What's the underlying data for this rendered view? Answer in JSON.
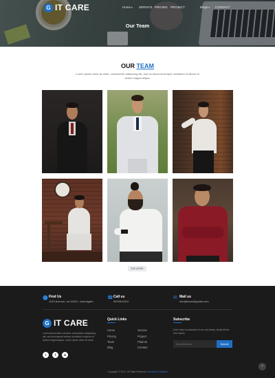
{
  "brand": {
    "logo_mark": "G",
    "name": "IT CARE"
  },
  "nav": {
    "items": [
      {
        "label": "Home",
        "has_caret": true
      },
      {
        "label": "SERVICE",
        "has_caret": false
      },
      {
        "label": "PRICING",
        "has_caret": false
      },
      {
        "label": "PROJECT",
        "has_caret": false
      },
      {
        "label": "Blogs",
        "has_caret": true
      },
      {
        "label": "CONTACT",
        "has_caret": false
      }
    ],
    "caret": "▾"
  },
  "hero": {
    "title": "Our Team"
  },
  "team": {
    "title_prefix": "OUR",
    "title_accent": "TEAM",
    "subtitle": "Lorem ipsum dolor sit amet, consectetur adipiscing elit, sed do eiusmod tempor incididunt ut labore et dolore magna aliqua.",
    "see_more": "SEE MORE",
    "accent_color": "#1f6fc4"
  },
  "footer": {
    "contacts": [
      {
        "icon": "map-marker-icon",
        "glyph": "⬤",
        "label": "Find Us",
        "value": "1010 Avenue, sw 54321, chandigarh"
      },
      {
        "icon": "phone-icon",
        "glyph": "☎",
        "label": "Call us",
        "value": "9876543210"
      },
      {
        "icon": "mail-icon",
        "glyph": "✉",
        "label": "Mail us",
        "value": "info@itcare@gmail.com"
      }
    ],
    "about": "Lorem ipsum dolor sit amet, consectetur adipisicing elit, sed do eiusmod tempor incididunt ut labore et dolore magna aliqua. Lorem ipsum dolor sit amet.",
    "socials": [
      {
        "name": "twitter",
        "glyph": "t"
      },
      {
        "name": "facebook",
        "glyph": "f"
      },
      {
        "name": "linkedin",
        "glyph": "in"
      }
    ],
    "quick_links_title": "Quick Links",
    "quick_links": [
      [
        "Home",
        "Service"
      ],
      [
        "Pricing",
        "Project"
      ],
      [
        "Team",
        "Planner"
      ],
      [
        "Blog",
        "Contact"
      ]
    ],
    "subscribe_title": "Subscribe",
    "subscribe_text": "Don't miss to subscribe to our new feeds, kindly fill the form below.",
    "email_placeholder": "Email Address",
    "submit_label": "Submit",
    "copyright_text": "Copyright © 2021, All Right Reserved",
    "copyright_brand": "Learned by Shipera",
    "back_to_top": "^"
  }
}
